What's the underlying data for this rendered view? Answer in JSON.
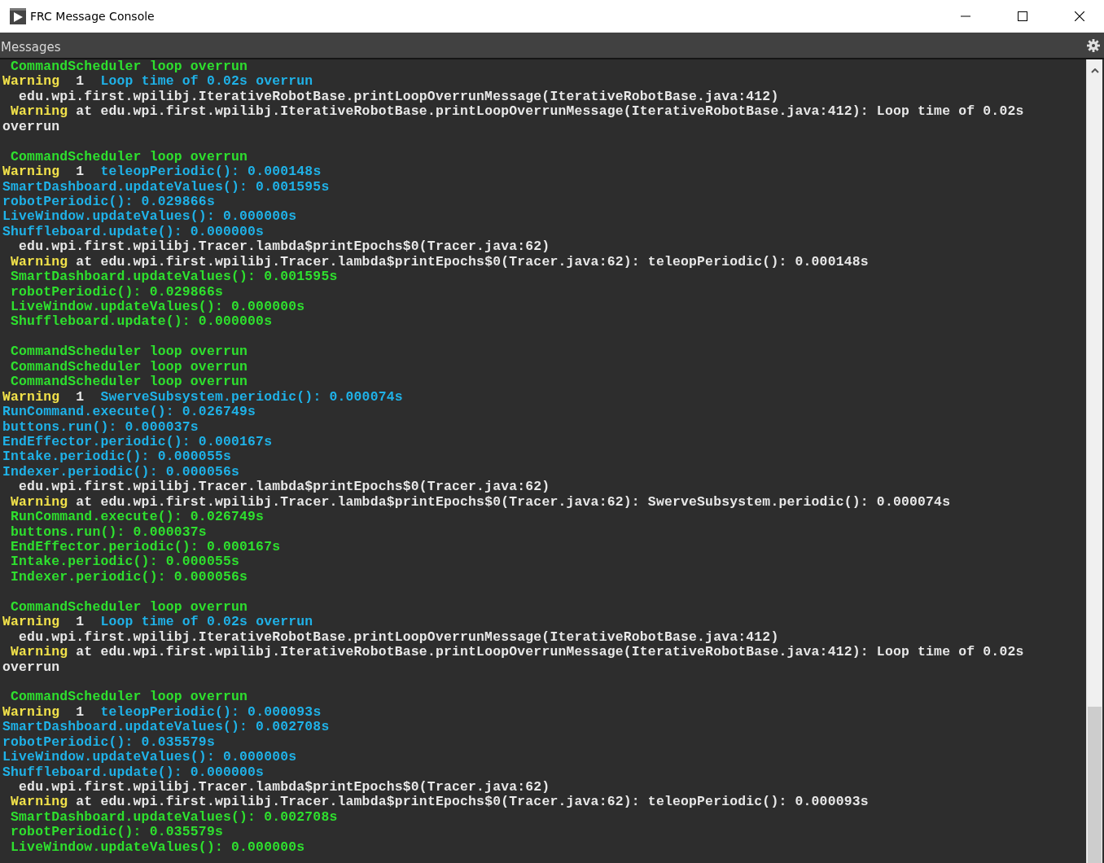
{
  "window": {
    "title": "FRC Message Console"
  },
  "panel": {
    "title": "Messages"
  },
  "log": [
    {
      "kind": "text",
      "segments": [
        {
          "text": " CommandScheduler loop overrun",
          "color": "#2ee02e"
        }
      ]
    },
    {
      "kind": "text",
      "segments": [
        {
          "text": "Warning",
          "color": "#f2e24a"
        },
        {
          "text": "  1  ",
          "color": "#e8e8e8"
        },
        {
          "text": "Loop time of 0.02s overrun",
          "color": "#1fb2e8"
        }
      ]
    },
    {
      "kind": "text",
      "segments": [
        {
          "text": "  edu.wpi.first.wpilibj.IterativeRobotBase.printLoopOverrunMessage(IterativeRobotBase.java:412)",
          "color": "#e8e8e8"
        }
      ]
    },
    {
      "kind": "text",
      "segments": [
        {
          "text": " Warning",
          "color": "#f2e24a"
        },
        {
          "text": " at edu.wpi.first.wpilibj.IterativeRobotBase.printLoopOverrunMessage(IterativeRobotBase.java:412): Loop time of 0.02s",
          "color": "#e8e8e8"
        }
      ]
    },
    {
      "kind": "text",
      "segments": [
        {
          "text": "overrun",
          "color": "#e8e8e8"
        }
      ]
    },
    {
      "kind": "gap"
    },
    {
      "kind": "text",
      "segments": [
        {
          "text": " CommandScheduler loop overrun",
          "color": "#2ee02e"
        }
      ]
    },
    {
      "kind": "text",
      "segments": [
        {
          "text": "Warning",
          "color": "#f2e24a"
        },
        {
          "text": "  1  ",
          "color": "#e8e8e8"
        },
        {
          "text": "teleopPeriodic(): 0.000148s",
          "color": "#1fb2e8"
        }
      ]
    },
    {
      "kind": "text",
      "segments": [
        {
          "text": "SmartDashboard.updateValues(): 0.001595s",
          "color": "#1fb2e8"
        }
      ]
    },
    {
      "kind": "text",
      "segments": [
        {
          "text": "robotPeriodic(): 0.029866s",
          "color": "#1fb2e8"
        }
      ]
    },
    {
      "kind": "text",
      "segments": [
        {
          "text": "LiveWindow.updateValues(): 0.000000s",
          "color": "#1fb2e8"
        }
      ]
    },
    {
      "kind": "text",
      "segments": [
        {
          "text": "Shuffleboard.update(): 0.000000s",
          "color": "#1fb2e8"
        }
      ]
    },
    {
      "kind": "text",
      "segments": [
        {
          "text": "  edu.wpi.first.wpilibj.Tracer.lambda$printEpochs$0(Tracer.java:62)",
          "color": "#e8e8e8"
        }
      ]
    },
    {
      "kind": "text",
      "segments": [
        {
          "text": " Warning",
          "color": "#f2e24a"
        },
        {
          "text": " at edu.wpi.first.wpilibj.Tracer.lambda$printEpochs$0(Tracer.java:62): teleopPeriodic(): 0.000148s",
          "color": "#e8e8e8"
        }
      ]
    },
    {
      "kind": "text",
      "segments": [
        {
          "text": " SmartDashboard.updateValues(): 0.001595s",
          "color": "#2ee02e"
        }
      ]
    },
    {
      "kind": "text",
      "segments": [
        {
          "text": " robotPeriodic(): 0.029866s",
          "color": "#2ee02e"
        }
      ]
    },
    {
      "kind": "text",
      "segments": [
        {
          "text": " LiveWindow.updateValues(): 0.000000s",
          "color": "#2ee02e"
        }
      ]
    },
    {
      "kind": "text",
      "segments": [
        {
          "text": " Shuffleboard.update(): 0.000000s",
          "color": "#2ee02e"
        }
      ]
    },
    {
      "kind": "gap"
    },
    {
      "kind": "text",
      "segments": [
        {
          "text": " CommandScheduler loop overrun",
          "color": "#2ee02e"
        }
      ]
    },
    {
      "kind": "text",
      "segments": [
        {
          "text": " CommandScheduler loop overrun",
          "color": "#2ee02e"
        }
      ]
    },
    {
      "kind": "text",
      "segments": [
        {
          "text": " CommandScheduler loop overrun",
          "color": "#2ee02e"
        }
      ]
    },
    {
      "kind": "text",
      "segments": [
        {
          "text": "Warning",
          "color": "#f2e24a"
        },
        {
          "text": "  1  ",
          "color": "#e8e8e8"
        },
        {
          "text": "SwerveSubsystem.periodic(): 0.000074s",
          "color": "#1fb2e8"
        }
      ]
    },
    {
      "kind": "text",
      "segments": [
        {
          "text": "RunCommand.execute(): 0.026749s",
          "color": "#1fb2e8"
        }
      ]
    },
    {
      "kind": "text",
      "segments": [
        {
          "text": "buttons.run(): 0.000037s",
          "color": "#1fb2e8"
        }
      ]
    },
    {
      "kind": "text",
      "segments": [
        {
          "text": "EndEffector.periodic(): 0.000167s",
          "color": "#1fb2e8"
        }
      ]
    },
    {
      "kind": "text",
      "segments": [
        {
          "text": "Intake.periodic(): 0.000055s",
          "color": "#1fb2e8"
        }
      ]
    },
    {
      "kind": "text",
      "segments": [
        {
          "text": "Indexer.periodic(): 0.000056s",
          "color": "#1fb2e8"
        }
      ]
    },
    {
      "kind": "text",
      "segments": [
        {
          "text": "  edu.wpi.first.wpilibj.Tracer.lambda$printEpochs$0(Tracer.java:62)",
          "color": "#e8e8e8"
        }
      ]
    },
    {
      "kind": "text",
      "segments": [
        {
          "text": " Warning",
          "color": "#f2e24a"
        },
        {
          "text": " at edu.wpi.first.wpilibj.Tracer.lambda$printEpochs$0(Tracer.java:62): SwerveSubsystem.periodic(): 0.000074s",
          "color": "#e8e8e8"
        }
      ]
    },
    {
      "kind": "text",
      "segments": [
        {
          "text": " RunCommand.execute(): 0.026749s",
          "color": "#2ee02e"
        }
      ]
    },
    {
      "kind": "text",
      "segments": [
        {
          "text": " buttons.run(): 0.000037s",
          "color": "#2ee02e"
        }
      ]
    },
    {
      "kind": "text",
      "segments": [
        {
          "text": " EndEffector.periodic(): 0.000167s",
          "color": "#2ee02e"
        }
      ]
    },
    {
      "kind": "text",
      "segments": [
        {
          "text": " Intake.periodic(): 0.000055s",
          "color": "#2ee02e"
        }
      ]
    },
    {
      "kind": "text",
      "segments": [
        {
          "text": " Indexer.periodic(): 0.000056s",
          "color": "#2ee02e"
        }
      ]
    },
    {
      "kind": "gap"
    },
    {
      "kind": "text",
      "segments": [
        {
          "text": " CommandScheduler loop overrun",
          "color": "#2ee02e"
        }
      ]
    },
    {
      "kind": "text",
      "segments": [
        {
          "text": "Warning",
          "color": "#f2e24a"
        },
        {
          "text": "  1  ",
          "color": "#e8e8e8"
        },
        {
          "text": "Loop time of 0.02s overrun",
          "color": "#1fb2e8"
        }
      ]
    },
    {
      "kind": "text",
      "segments": [
        {
          "text": "  edu.wpi.first.wpilibj.IterativeRobotBase.printLoopOverrunMessage(IterativeRobotBase.java:412)",
          "color": "#e8e8e8"
        }
      ]
    },
    {
      "kind": "text",
      "segments": [
        {
          "text": " Warning",
          "color": "#f2e24a"
        },
        {
          "text": " at edu.wpi.first.wpilibj.IterativeRobotBase.printLoopOverrunMessage(IterativeRobotBase.java:412): Loop time of 0.02s",
          "color": "#e8e8e8"
        }
      ]
    },
    {
      "kind": "text",
      "segments": [
        {
          "text": "overrun",
          "color": "#e8e8e8"
        }
      ]
    },
    {
      "kind": "gap"
    },
    {
      "kind": "text",
      "segments": [
        {
          "text": " CommandScheduler loop overrun",
          "color": "#2ee02e"
        }
      ]
    },
    {
      "kind": "text",
      "segments": [
        {
          "text": "Warning",
          "color": "#f2e24a"
        },
        {
          "text": "  1  ",
          "color": "#e8e8e8"
        },
        {
          "text": "teleopPeriodic(): 0.000093s",
          "color": "#1fb2e8"
        }
      ]
    },
    {
      "kind": "text",
      "segments": [
        {
          "text": "SmartDashboard.updateValues(): 0.002708s",
          "color": "#1fb2e8"
        }
      ]
    },
    {
      "kind": "text",
      "segments": [
        {
          "text": "robotPeriodic(): 0.035579s",
          "color": "#1fb2e8"
        }
      ]
    },
    {
      "kind": "text",
      "segments": [
        {
          "text": "LiveWindow.updateValues(): 0.000000s",
          "color": "#1fb2e8"
        }
      ]
    },
    {
      "kind": "text",
      "segments": [
        {
          "text": "Shuffleboard.update(): 0.000000s",
          "color": "#1fb2e8"
        }
      ]
    },
    {
      "kind": "text",
      "segments": [
        {
          "text": "  edu.wpi.first.wpilibj.Tracer.lambda$printEpochs$0(Tracer.java:62)",
          "color": "#e8e8e8"
        }
      ]
    },
    {
      "kind": "text",
      "segments": [
        {
          "text": " Warning",
          "color": "#f2e24a"
        },
        {
          "text": " at edu.wpi.first.wpilibj.Tracer.lambda$printEpochs$0(Tracer.java:62): teleopPeriodic(): 0.000093s",
          "color": "#e8e8e8"
        }
      ]
    },
    {
      "kind": "text",
      "segments": [
        {
          "text": " SmartDashboard.updateValues(): 0.002708s",
          "color": "#2ee02e"
        }
      ]
    },
    {
      "kind": "text",
      "segments": [
        {
          "text": " robotPeriodic(): 0.035579s",
          "color": "#2ee02e"
        }
      ]
    },
    {
      "kind": "text",
      "segments": [
        {
          "text": " LiveWindow.updateValues(): 0.000000s",
          "color": "#2ee02e"
        }
      ]
    }
  ]
}
